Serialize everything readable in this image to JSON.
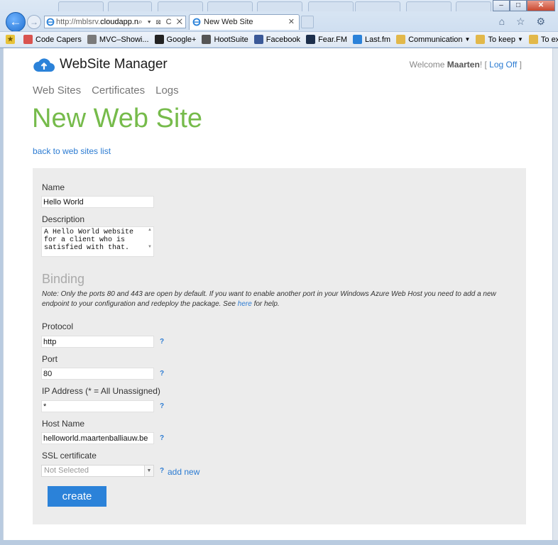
{
  "browser": {
    "address_prefix": "http://mblsrv.",
    "address_host": "cloudapp.net",
    "address_tools": "⌕ ▾ ⊠ C ✕",
    "tab_title": "New Web Site",
    "tab_close": "✕",
    "back_glyph": "←",
    "forward_glyph": "→",
    "window_controls": [
      "–",
      "□",
      "✕"
    ],
    "tool_icons": "⌂ ☆ ⚙",
    "favorites": [
      {
        "label": "Code Capers",
        "icon": "pencil-icon",
        "color": "#d9534f"
      },
      {
        "label": "MVC–Showi...",
        "icon": "page-icon",
        "color": "#7a7a7a"
      },
      {
        "label": "Google+",
        "icon": "google-plus-icon",
        "color": "#222222"
      },
      {
        "label": "HootSuite",
        "icon": "owl-icon",
        "color": "#555555"
      },
      {
        "label": "Facebook",
        "icon": "facebook-icon",
        "color": "#3b5998"
      },
      {
        "label": "Fear.FM",
        "icon": "fearfm-icon",
        "color": "#1c2f4c"
      },
      {
        "label": "Last.fm",
        "icon": "ie-page-icon",
        "color": "#2b82d9"
      },
      {
        "label": "Communication",
        "icon": "folder-icon",
        "color": "#e2b84a",
        "dropdown": true
      },
      {
        "label": "To keep",
        "icon": "folder-icon",
        "color": "#e2b84a",
        "dropdown": true
      },
      {
        "label": "To explore",
        "icon": "folder-icon",
        "color": "#e2b84a",
        "dropdown": true
      }
    ]
  },
  "header": {
    "brand": "WebSite Manager",
    "welcome_prefix": "Welcome",
    "user": "Maarten",
    "welcome_suffix": "! [",
    "logoff": "Log Off",
    "welcome_end": "]"
  },
  "nav": [
    "Web Sites",
    "Certificates",
    "Logs"
  ],
  "page": {
    "title": "New Web Site",
    "back_link": "back to web sites list"
  },
  "form": {
    "name_label": "Name",
    "name_value": "Hello World",
    "description_label": "Description",
    "description_value": "A Hello World website\nfor a client who is\nsatisfied with that.",
    "binding_heading": "Binding",
    "binding_note_before": "Note: Only the ports 80 and 443 are open by default. If you want to enable another port in your Windows Azure Web Host you need to add a new endpoint to your configuration and redeploy the package. See",
    "binding_note_link": "here",
    "binding_note_after": "for help.",
    "protocol_label": "Protocol",
    "protocol_value": "http",
    "port_label": "Port",
    "port_value": "80",
    "ip_label": "IP Address (* = All Unassigned)",
    "ip_value": "*",
    "host_label": "Host Name",
    "host_value": "helloworld.maartenballiauw.be",
    "ssl_label": "SSL certificate",
    "ssl_selected": "Not Selected",
    "help_mark": "?",
    "add_new": "add new",
    "create": "create"
  },
  "colors": {
    "title_green": "#76bb4b",
    "link_blue": "#2b7bd2",
    "button_blue": "#2b82d9",
    "panel_gray": "#ececec"
  }
}
